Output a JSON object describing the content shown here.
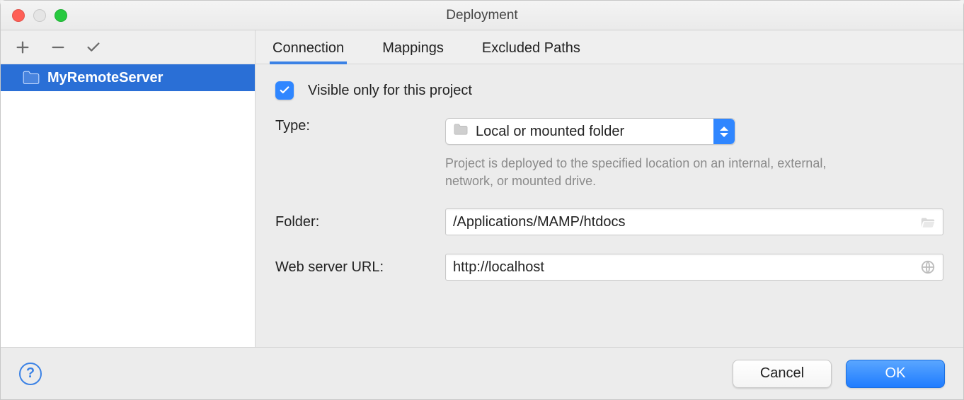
{
  "window": {
    "title": "Deployment"
  },
  "sidebar": {
    "toolbar_icons": {
      "add": "plus-icon",
      "remove": "minus-icon",
      "check": "check-icon"
    },
    "items": [
      {
        "label": "MyRemoteServer",
        "selected": true,
        "icon": "folder-icon"
      }
    ]
  },
  "tabs": [
    {
      "label": "Connection",
      "active": true
    },
    {
      "label": "Mappings",
      "active": false
    },
    {
      "label": "Excluded Paths",
      "active": false
    }
  ],
  "form": {
    "visible_only": {
      "checked": true,
      "label": "Visible only for this project"
    },
    "type": {
      "label": "Type:",
      "selected": "Local or mounted folder",
      "icon": "folder-icon",
      "hint": "Project is deployed to the specified location on an internal, external, network, or mounted drive."
    },
    "folder": {
      "label": "Folder:",
      "value": "/Applications/MAMP/htdocs"
    },
    "url": {
      "label": "Web server URL:",
      "value": "http://localhost"
    }
  },
  "footer": {
    "cancel": "Cancel",
    "ok": "OK"
  }
}
